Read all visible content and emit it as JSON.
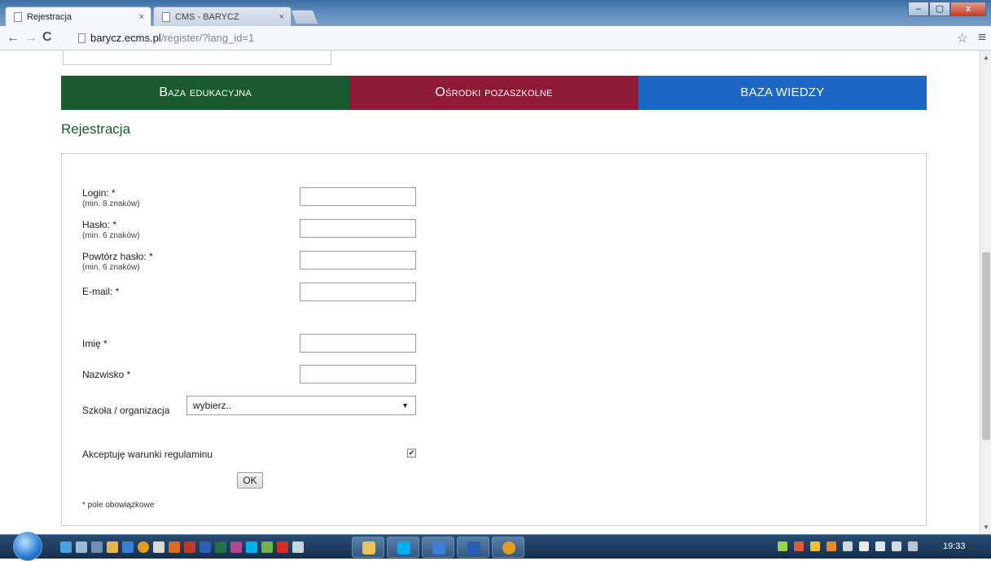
{
  "browser": {
    "tabs": [
      {
        "title": "Rejestracja",
        "close": "×"
      },
      {
        "title": "CMS - BARYCZ",
        "close": "×"
      }
    ],
    "url_host": "barycz.ecms.pl",
    "url_path": "/register/?lang_id=1",
    "window_buttons": {
      "minimize": "–",
      "maximize": "▢",
      "close": "x"
    }
  },
  "nav": [
    {
      "label": "Baza edukacyjna",
      "color": "#1b5a2e"
    },
    {
      "label": "Ośrodki pozaszkolne",
      "color": "#8f1a37"
    },
    {
      "label": "BAZA WIEDZY",
      "color": "#1c66c4"
    }
  ],
  "page_title": "Rejestracja",
  "form": {
    "fields": [
      {
        "label": "Login: *",
        "hint": "(min. 8 znaków)",
        "value": ""
      },
      {
        "label": "Hasło: *",
        "hint": "(min. 6 znaków)",
        "value": ""
      },
      {
        "label": "Powtórz hasło: *",
        "hint": "(min. 6 znaków)",
        "value": ""
      },
      {
        "label": "E-mail: *",
        "hint": "",
        "value": ""
      },
      {
        "label": "Imię *",
        "hint": "",
        "value": ""
      },
      {
        "label": "Nazwisko *",
        "hint": "",
        "value": ""
      }
    ],
    "school_label": "Szkoła / organizacja",
    "school_value": "wybierz..",
    "accept_label": "Akceptuję warunki regulaminu",
    "accept_checked": "✔",
    "ok_label": "OK",
    "required_note": "* pole obowiązkowe"
  },
  "taskbar": {
    "clock": "19:33"
  }
}
